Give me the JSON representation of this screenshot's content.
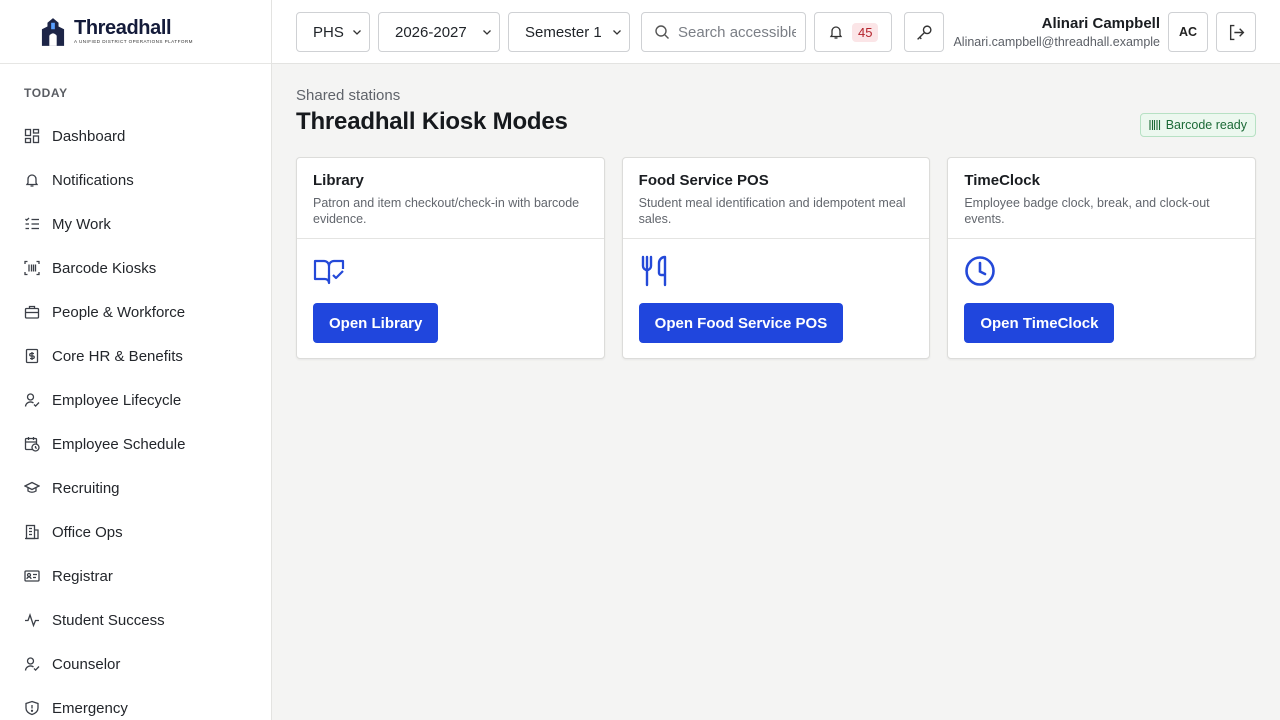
{
  "brand": {
    "name": "Threadhall",
    "tagline": "A unified district operations platform"
  },
  "sidebar": {
    "section_label": "TODAY",
    "items": [
      {
        "label": "Dashboard",
        "icon": "dashboard-icon"
      },
      {
        "label": "Notifications",
        "icon": "bell-icon"
      },
      {
        "label": "My Work",
        "icon": "list-check-icon"
      },
      {
        "label": "Barcode Kiosks",
        "icon": "barcode-scan-icon"
      },
      {
        "label": "People & Workforce",
        "icon": "briefcase-icon"
      },
      {
        "label": "Core HR & Benefits",
        "icon": "dollar-document-icon"
      },
      {
        "label": "Employee Lifecycle",
        "icon": "user-check-icon"
      },
      {
        "label": "Employee Schedule",
        "icon": "calendar-clock-icon"
      },
      {
        "label": "Recruiting",
        "icon": "graduation-cap-icon"
      },
      {
        "label": "Office Ops",
        "icon": "building-icon"
      },
      {
        "label": "Registrar",
        "icon": "id-card-icon"
      },
      {
        "label": "Student Success",
        "icon": "activity-icon"
      },
      {
        "label": "Counselor",
        "icon": "user-check-icon"
      },
      {
        "label": "Emergency",
        "icon": "shield-icon"
      }
    ]
  },
  "topbar": {
    "school": "PHS",
    "year": "2026-2027",
    "term": "Semester 1",
    "search_placeholder": "Search accessible",
    "notification_count": "45",
    "user_name": "Alinari Campbell",
    "user_email": "Alinari.campbell@threadhall.example",
    "avatar_initials": "AC"
  },
  "main": {
    "eyebrow": "Shared stations",
    "title": "Threadhall Kiosk Modes",
    "status_badge": "Barcode ready",
    "cards": [
      {
        "title": "Library",
        "description": "Patron and item checkout/check-in with barcode evidence.",
        "button": "Open Library",
        "icon": "book-check-icon"
      },
      {
        "title": "Food Service POS",
        "description": "Student meal identification and idempotent meal sales.",
        "button": "Open Food Service POS",
        "icon": "utensils-icon"
      },
      {
        "title": "TimeClock",
        "description": "Employee badge clock, break, and clock-out events.",
        "button": "Open TimeClock",
        "icon": "clock-icon"
      }
    ]
  },
  "colors": {
    "accent": "#2046dd",
    "success_bg": "#ecf8ef",
    "success_text": "#1c6a37",
    "badge_bg": "#fbe5e7",
    "badge_text": "#b4232c"
  }
}
